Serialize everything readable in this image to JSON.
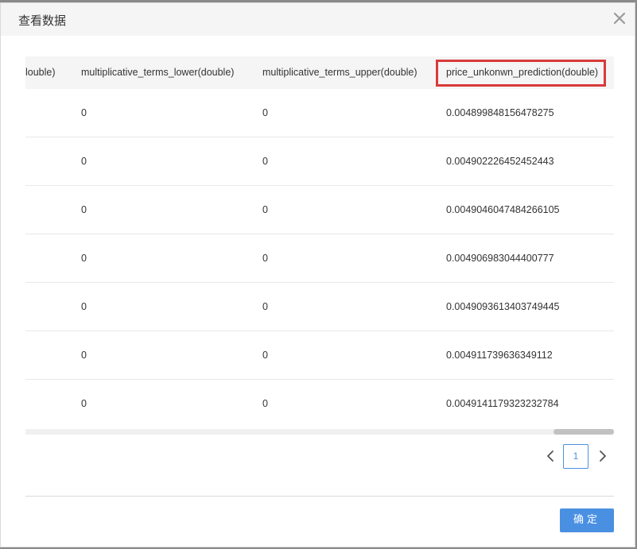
{
  "dialog": {
    "title": "查看数据",
    "close_icon": "close-icon"
  },
  "table": {
    "columns": [
      {
        "key": "col_partial",
        "label": "louble)"
      },
      {
        "key": "mt_lower",
        "label": "multiplicative_terms_lower(double)"
      },
      {
        "key": "mt_upper",
        "label": "multiplicative_terms_upper(double)"
      },
      {
        "key": "price_pred",
        "label": "price_unkonwn_prediction(double)",
        "highlighted": true
      }
    ],
    "rows": [
      {
        "col_partial": "",
        "mt_lower": "0",
        "mt_upper": "0",
        "price_pred": "0.004899848156478275"
      },
      {
        "col_partial": "",
        "mt_lower": "0",
        "mt_upper": "0",
        "price_pred": "0.004902226452452443"
      },
      {
        "col_partial": "",
        "mt_lower": "0",
        "mt_upper": "0",
        "price_pred": "0.0049046047484266105"
      },
      {
        "col_partial": "",
        "mt_lower": "0",
        "mt_upper": "0",
        "price_pred": "0.004906983044400777"
      },
      {
        "col_partial": "",
        "mt_lower": "0",
        "mt_upper": "0",
        "price_pred": "0.0049093613403749445"
      },
      {
        "col_partial": "",
        "mt_lower": "0",
        "mt_upper": "0",
        "price_pred": "0.004911739636349112"
      },
      {
        "col_partial": "",
        "mt_lower": "0",
        "mt_upper": "0",
        "price_pred": "0.0049141179323232784"
      }
    ],
    "highlight_color": "#d93a3a"
  },
  "pagination": {
    "current_page": "1",
    "prev_icon": "chevron-left-icon",
    "next_icon": "chevron-right-icon",
    "accent": "#4a90e2"
  },
  "footer": {
    "ok_label": "确定"
  }
}
